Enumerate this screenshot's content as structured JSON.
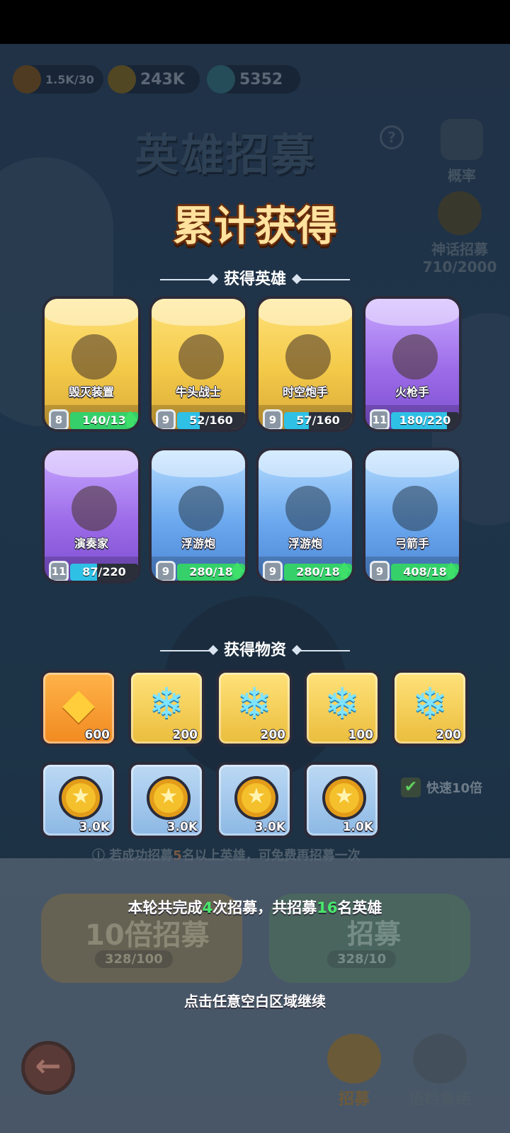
{
  "resources": {
    "energy": "1.5K/30",
    "gold": "243K",
    "gems": "5352"
  },
  "background": {
    "title": "英雄招募",
    "help_glyph": "?",
    "probability_label": "概率",
    "myth_label": "神话招募",
    "myth_progress": "710/2000"
  },
  "overlay": {
    "headline": "累计获得",
    "heroes_section": "获得英雄",
    "items_section": "获得物资"
  },
  "heroes": [
    {
      "name": "毁灭装置",
      "level": "8",
      "progress": "140/13",
      "fill": 1.0,
      "color": "gold",
      "upgrade": true
    },
    {
      "name": "牛头战士",
      "level": "9",
      "progress": "52/160",
      "fill": 0.33,
      "color": "gold",
      "upgrade": false
    },
    {
      "name": "时空炮手",
      "level": "9",
      "progress": "57/160",
      "fill": 0.36,
      "color": "gold",
      "upgrade": false
    },
    {
      "name": "火枪手",
      "level": "11",
      "progress": "180/220",
      "fill": 0.82,
      "color": "purple",
      "upgrade": false
    },
    {
      "name": "演奏家",
      "level": "11",
      "progress": "87/220",
      "fill": 0.4,
      "color": "purple",
      "upgrade": false
    },
    {
      "name": "浮游炮",
      "level": "9",
      "progress": "280/18",
      "fill": 1.0,
      "color": "blue",
      "upgrade": true
    },
    {
      "name": "浮游炮",
      "level": "9",
      "progress": "280/18",
      "fill": 1.0,
      "color": "blue",
      "upgrade": true
    },
    {
      "name": "弓箭手",
      "level": "9",
      "progress": "408/18",
      "fill": 1.0,
      "color": "blue",
      "upgrade": true
    }
  ],
  "items": [
    {
      "icon": "crystal-icon",
      "amount": "600",
      "frame": "orange"
    },
    {
      "icon": "gem-icon",
      "amount": "200",
      "frame": "gold"
    },
    {
      "icon": "gem-icon",
      "amount": "200",
      "frame": "gold"
    },
    {
      "icon": "gem-icon",
      "amount": "100",
      "frame": "gold"
    },
    {
      "icon": "gem-icon",
      "amount": "200",
      "frame": "gold"
    },
    {
      "icon": "coin-icon",
      "amount": "3.0K",
      "frame": "lightblue"
    },
    {
      "icon": "coin-icon",
      "amount": "3.0K",
      "frame": "lightblue"
    },
    {
      "icon": "coin-icon",
      "amount": "3.0K",
      "frame": "lightblue"
    },
    {
      "icon": "coin-icon",
      "amount": "1.0K",
      "frame": "lightblue"
    }
  ],
  "quick_toggle": {
    "label": "快速10倍",
    "checked": true
  },
  "info_tip": {
    "prefix": "若成功招募",
    "number": "5",
    "suffix": "名以上英雄，可免费再招募一次"
  },
  "buttons": {
    "ten_times": {
      "label": "10倍招募",
      "cost": "328/100"
    },
    "recruit": {
      "label": "招募",
      "cost": "328/10"
    }
  },
  "summary": {
    "part1": "本轮共完成",
    "count1": "4",
    "part2": "次招募，共招募",
    "count2": "16",
    "part3": "名英雄"
  },
  "continue_hint": "点击任意空白区域继续",
  "nav": {
    "back_glyph": "←",
    "recruit": "招募",
    "team": "搭档集结"
  }
}
